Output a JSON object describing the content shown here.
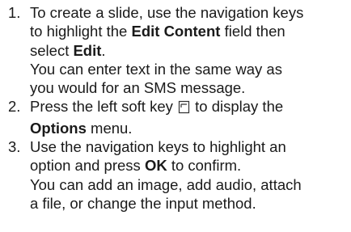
{
  "steps": [
    {
      "number": "1.",
      "l1": "To create a slide, use the navigation keys",
      "l2a": "to highlight the ",
      "l2b": "Edit Content",
      "l2c": " field then",
      "l3a": "select ",
      "l3b": "Edit",
      "l3c": ".",
      "l4": "You can enter text in the same way as",
      "l5": "you would for an SMS message."
    },
    {
      "number": "2.",
      "l1a": "Press the left soft key ",
      "l1b": " to display the",
      "l2a": "Options",
      "l2b": " menu.",
      "icon": "left-soft-key-icon"
    },
    {
      "number": "3.",
      "l1": "Use the navigation keys to highlight an",
      "l2a": "option and press ",
      "l2b": "OK",
      "l2c": " to confirm.",
      "l3": "You can add an image, add audio, attach",
      "l4": "a file, or change the input method."
    }
  ]
}
